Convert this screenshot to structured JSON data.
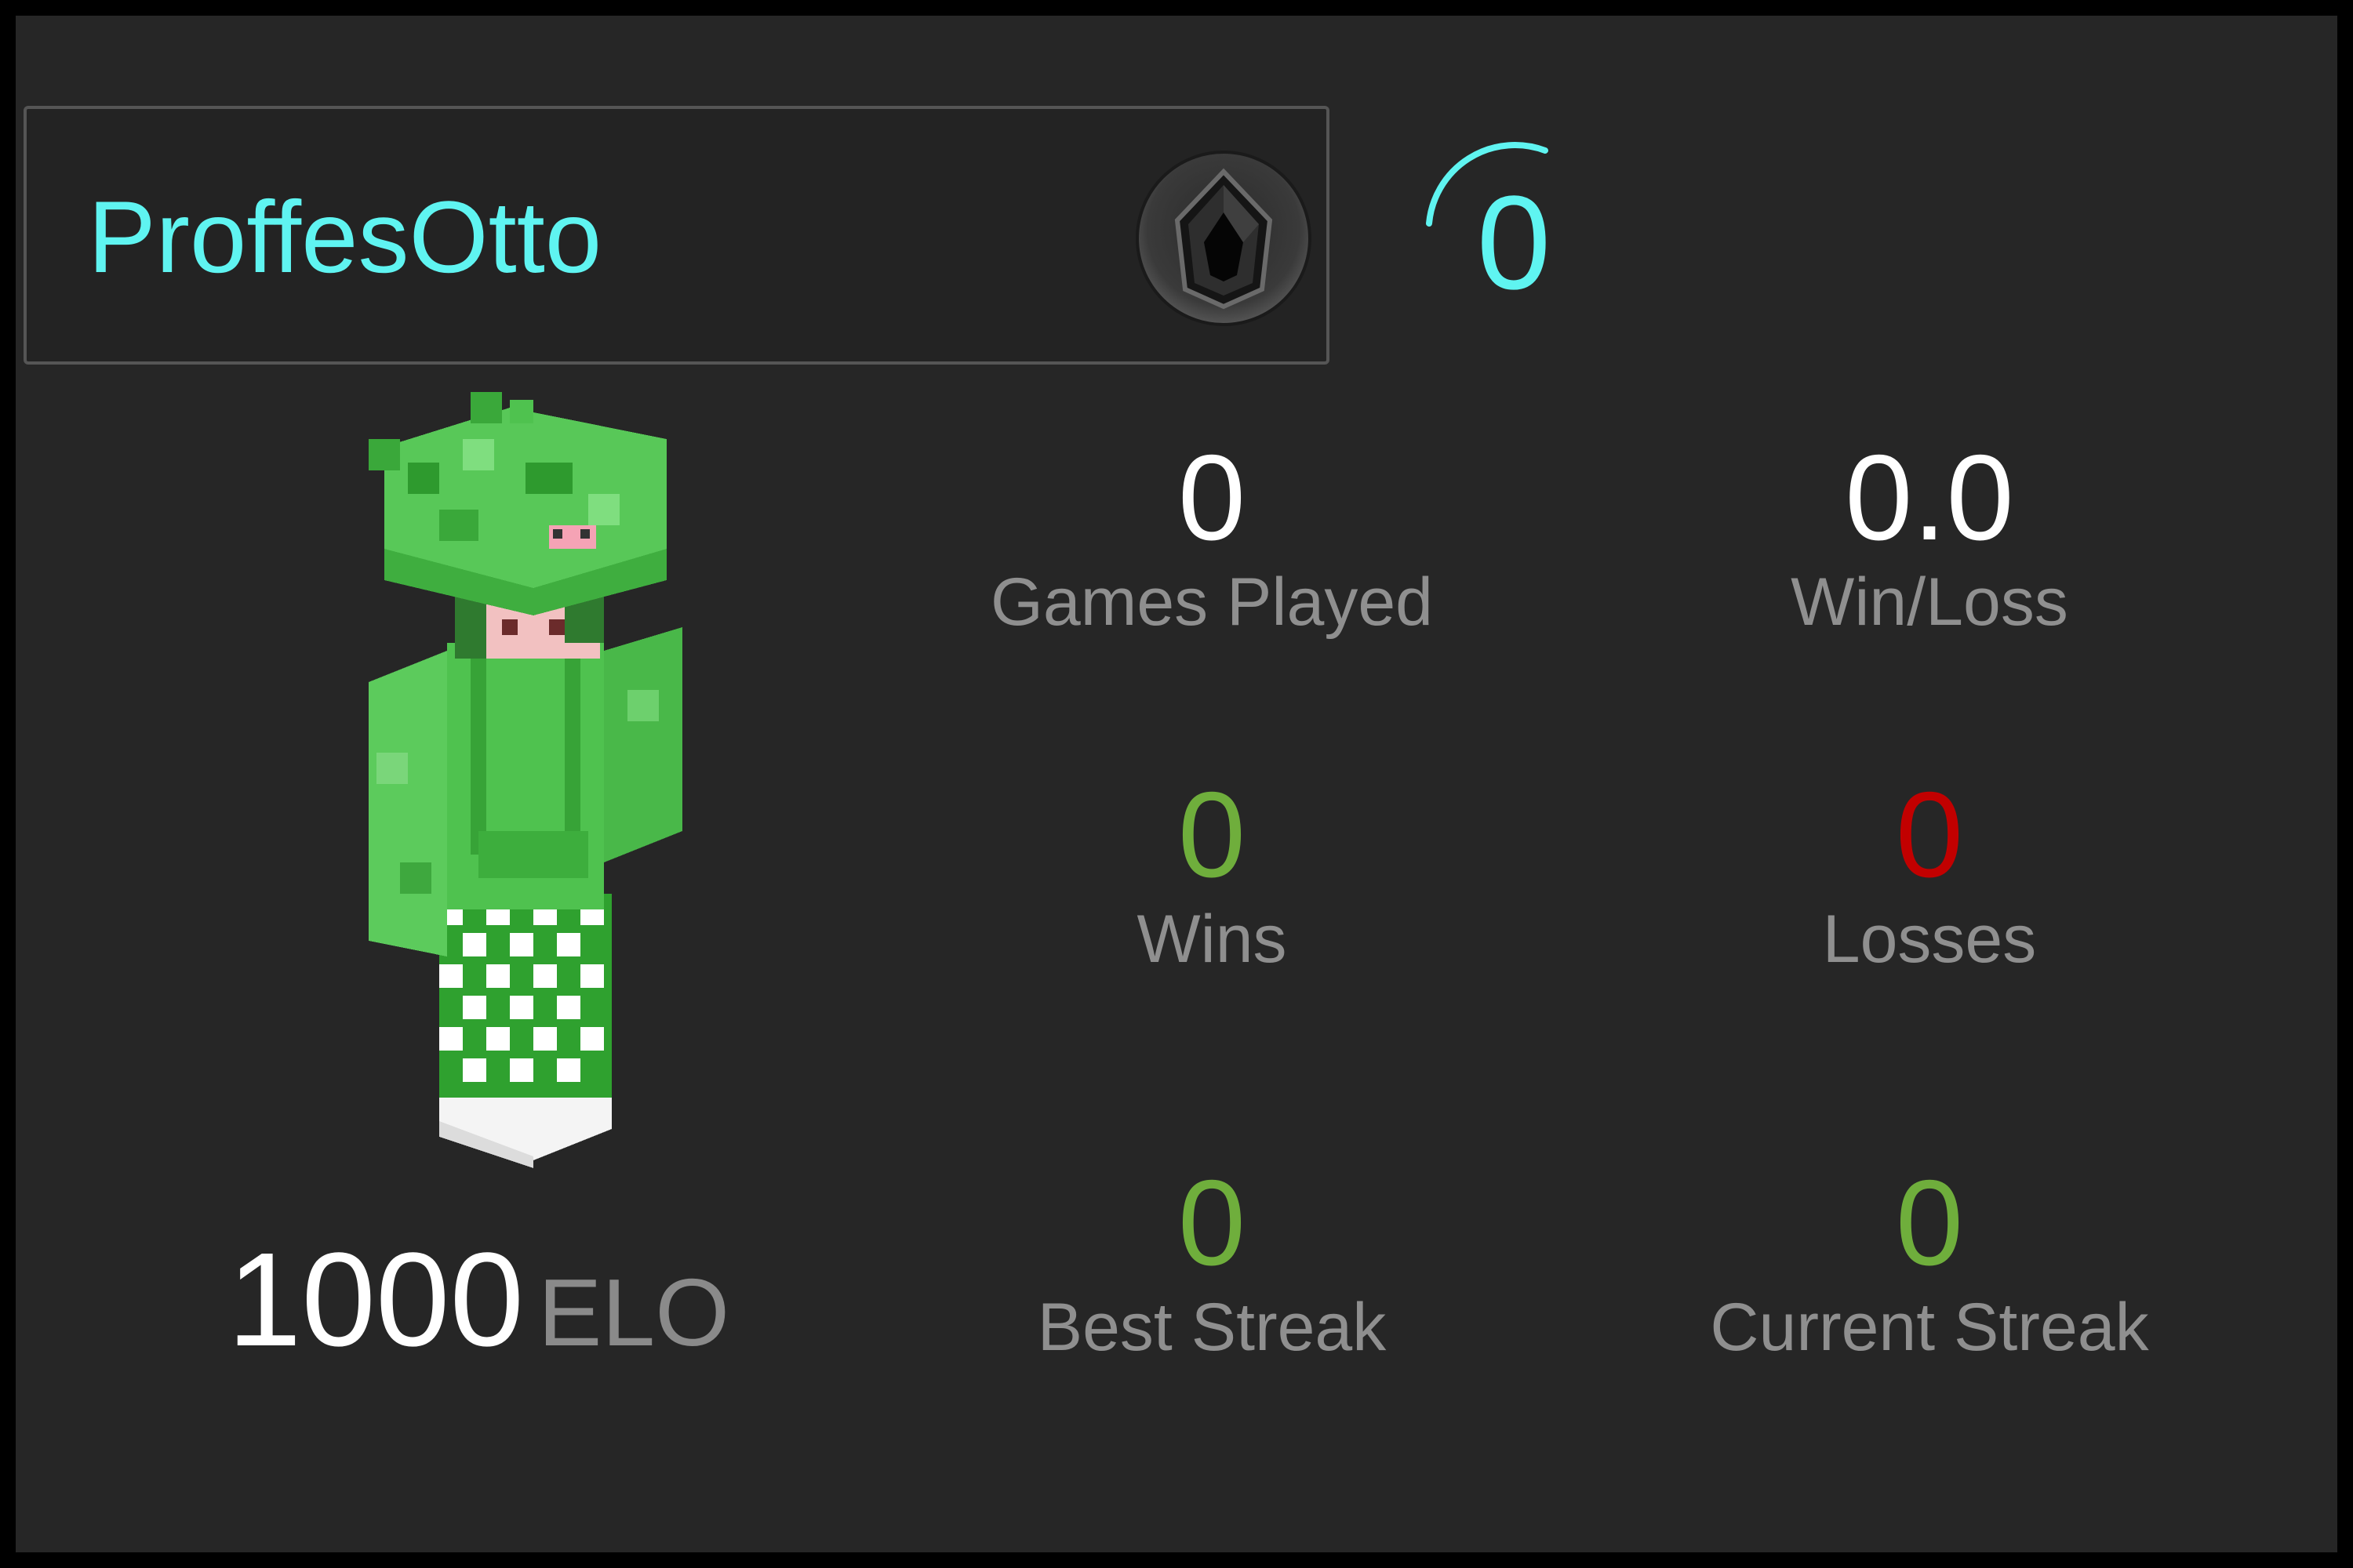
{
  "player": {
    "name": "ProffesOtto",
    "level": "0",
    "elo_value": "1000",
    "elo_unit": "ELO"
  },
  "icons": {
    "rank_badge": "obsidian-gem-icon",
    "level_arc": "level-progress-arc-icon",
    "skin": "minecraft-player-skin"
  },
  "colors": {
    "name": "#5ff4f1",
    "win": "#6fae3c",
    "loss": "#c20000",
    "label": "#8f8f8f",
    "background": "#262626"
  },
  "stats": {
    "games_played": {
      "value": "0",
      "label": "Games Played"
    },
    "win_loss": {
      "value": "0.0",
      "label": "Win/Loss"
    },
    "wins": {
      "value": "0",
      "label": "Wins"
    },
    "losses": {
      "value": "0",
      "label": "Losses"
    },
    "best_streak": {
      "value": "0",
      "label": "Best Streak"
    },
    "current_streak": {
      "value": "0",
      "label": "Current Streak"
    }
  }
}
